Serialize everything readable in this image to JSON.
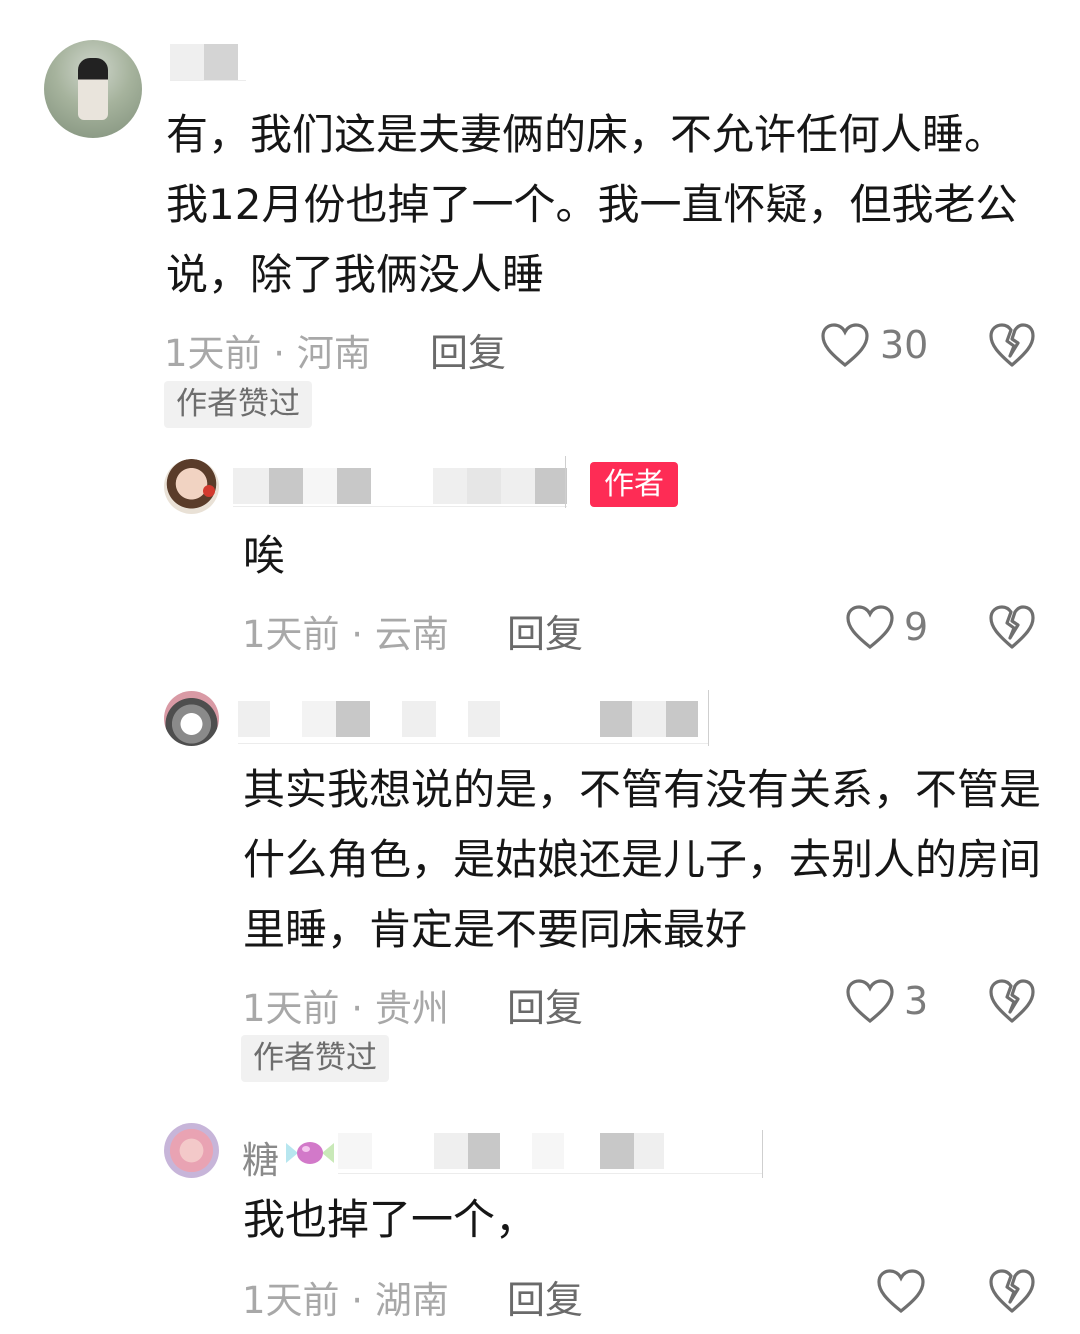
{
  "comments": [
    {
      "text": "有，我们这是夫妻俩的床，不允许任何人睡。我12月份也掉了一个。我一直怀疑，但我老公说，除了我俩没人睡",
      "meta": "1天前 · 河南",
      "reply_label": "回复",
      "likes": "30",
      "author_liked_tag": "作者赞过"
    },
    {
      "badge": "作者",
      "text": "唉",
      "meta": "1天前 · 云南",
      "reply_label": "回复",
      "likes": "9"
    },
    {
      "text": "其实我想说的是，不管有没有关系，不管是什么角色，是姑娘还是儿子，去别人的房间里睡，肯定是不要同床最好",
      "meta": "1天前 · 贵州",
      "reply_label": "回复",
      "likes": "3",
      "author_liked_tag": "作者赞过"
    },
    {
      "nickname": "糖",
      "text": "我也掉了一个，",
      "meta": "1天前 · 湖南",
      "reply_label": "回复"
    }
  ],
  "icons": {
    "like": "heart-outline-icon",
    "dislike": "broken-heart-icon",
    "candy": "candy-icon"
  },
  "colors": {
    "author_badge": "#fe2c55",
    "meta_text": "#a8a8a8",
    "main_text": "#161616"
  }
}
